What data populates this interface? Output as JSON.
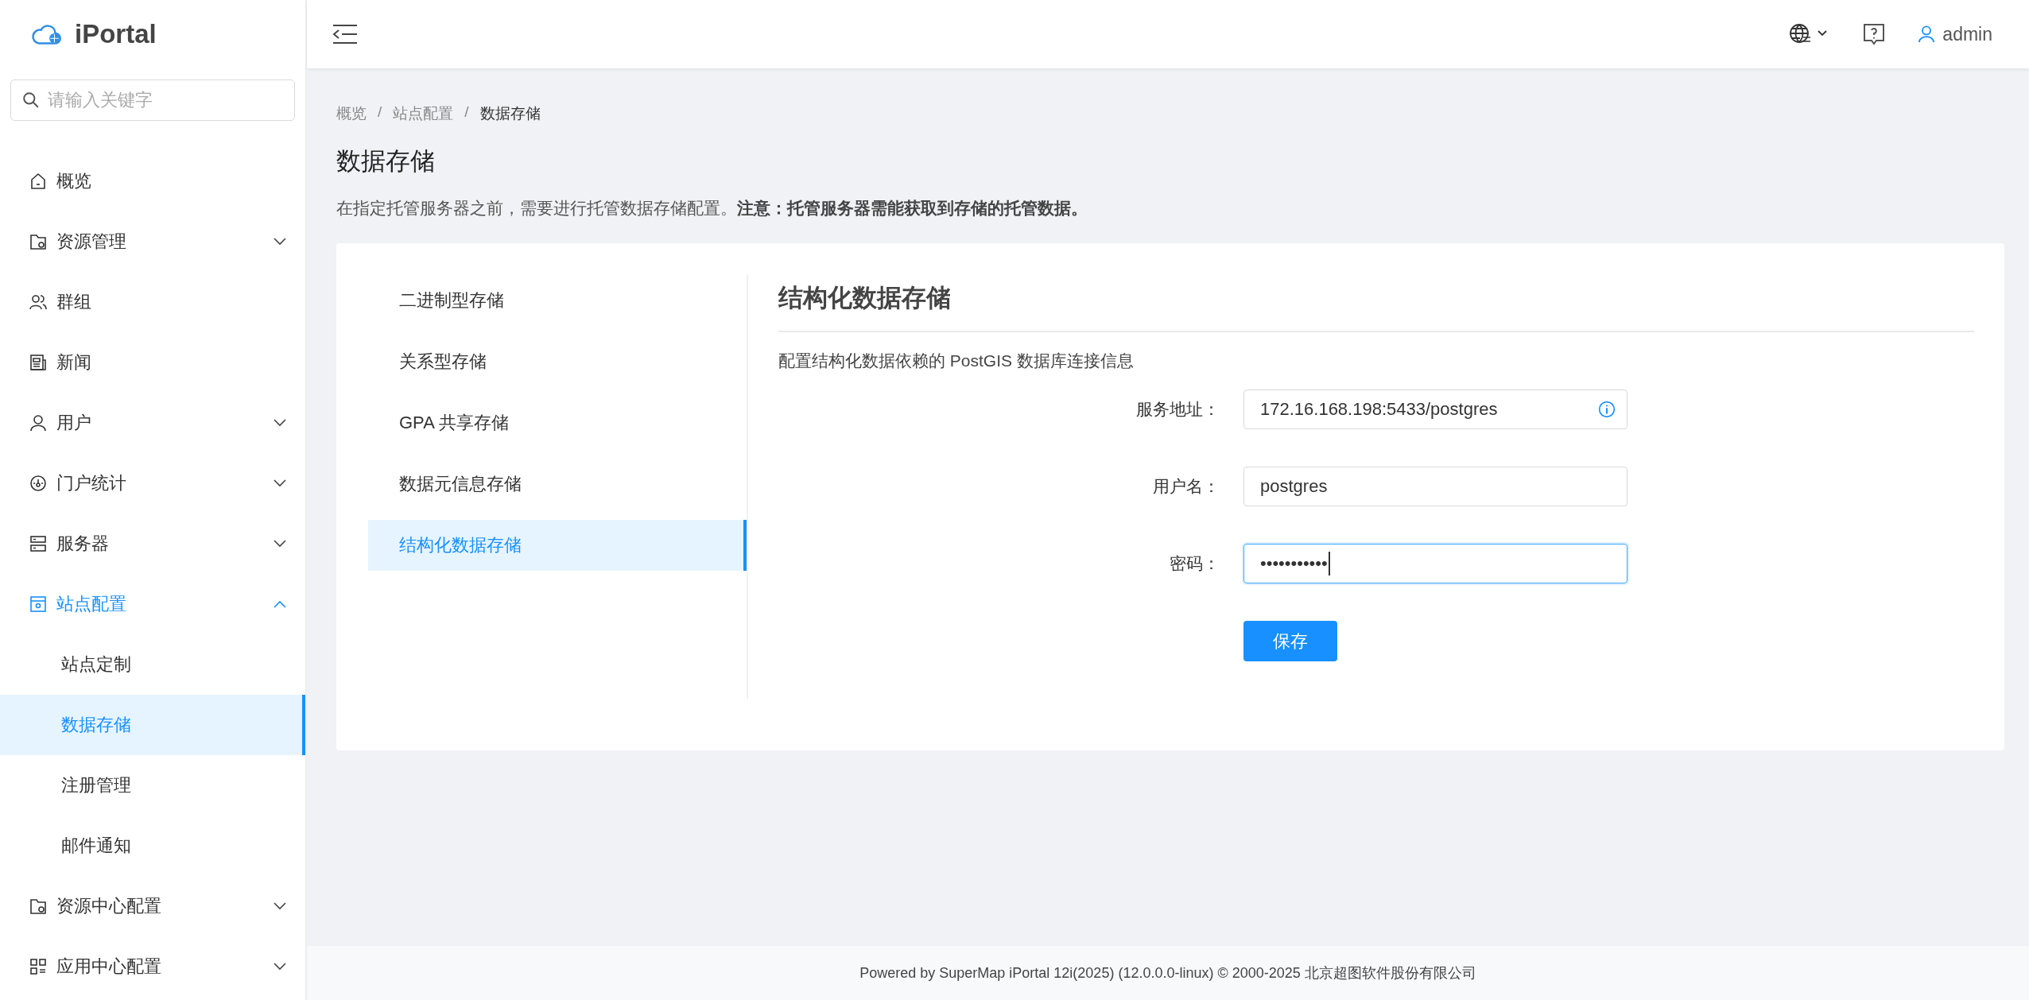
{
  "brand": {
    "name": "iPortal"
  },
  "search": {
    "placeholder": "请输入关键字"
  },
  "sidebar": {
    "items": [
      {
        "kind": "link",
        "label": "概览",
        "selected": false
      },
      {
        "kind": "group",
        "label": "资源管理",
        "expanded": false
      },
      {
        "kind": "link",
        "label": "群组",
        "selected": false
      },
      {
        "kind": "link",
        "label": "新闻",
        "selected": false
      },
      {
        "kind": "group",
        "label": "用户",
        "expanded": false
      },
      {
        "kind": "group",
        "label": "门户统计",
        "expanded": false
      },
      {
        "kind": "group",
        "label": "服务器",
        "expanded": false
      },
      {
        "kind": "group",
        "label": "站点配置",
        "expanded": true,
        "children": [
          {
            "label": "站点定制",
            "selected": false
          },
          {
            "label": "数据存储",
            "selected": true
          },
          {
            "label": "注册管理",
            "selected": false
          },
          {
            "label": "邮件通知",
            "selected": false
          }
        ]
      },
      {
        "kind": "group",
        "label": "资源中心配置",
        "expanded": false
      },
      {
        "kind": "group",
        "label": "应用中心配置",
        "expanded": false
      }
    ]
  },
  "header": {
    "user": "admin"
  },
  "breadcrumb": {
    "items": [
      "概览",
      "站点配置",
      "数据存储"
    ],
    "separators": [
      "/",
      "/"
    ]
  },
  "page": {
    "title": "数据存储",
    "description": "在指定托管服务器之前，需要进行托管数据存储配置。**注意：托管服务器需能获取到存储的托管数据。**"
  },
  "storage_tabs": [
    {
      "label": "二进制型存储",
      "selected": false
    },
    {
      "label": "关系型存储",
      "selected": false
    },
    {
      "label": "GPA 共享存储",
      "selected": false
    },
    {
      "label": "数据元信息存储",
      "selected": false
    },
    {
      "label": "结构化数据存储",
      "selected": true
    }
  ],
  "panel": {
    "title": "结构化数据存储",
    "subtitle": "配置结构化数据依赖的 PostGIS 数据库连接信息",
    "fields": [
      {
        "label": "服务地址：",
        "value": "172.16.168.198:5433/postgres",
        "info": true,
        "focused": false
      },
      {
        "label": "用户名：",
        "value": "postgres",
        "info": false,
        "focused": false
      },
      {
        "label": "密码：",
        "value": "•••••••••••",
        "info": false,
        "focused": true
      }
    ],
    "save_button": "保存"
  },
  "footer": "Powered by SuperMap iPortal 12i(2025) (12.0.0.0-linux) © 2000-2025 北京超图软件股份有限公司"
}
